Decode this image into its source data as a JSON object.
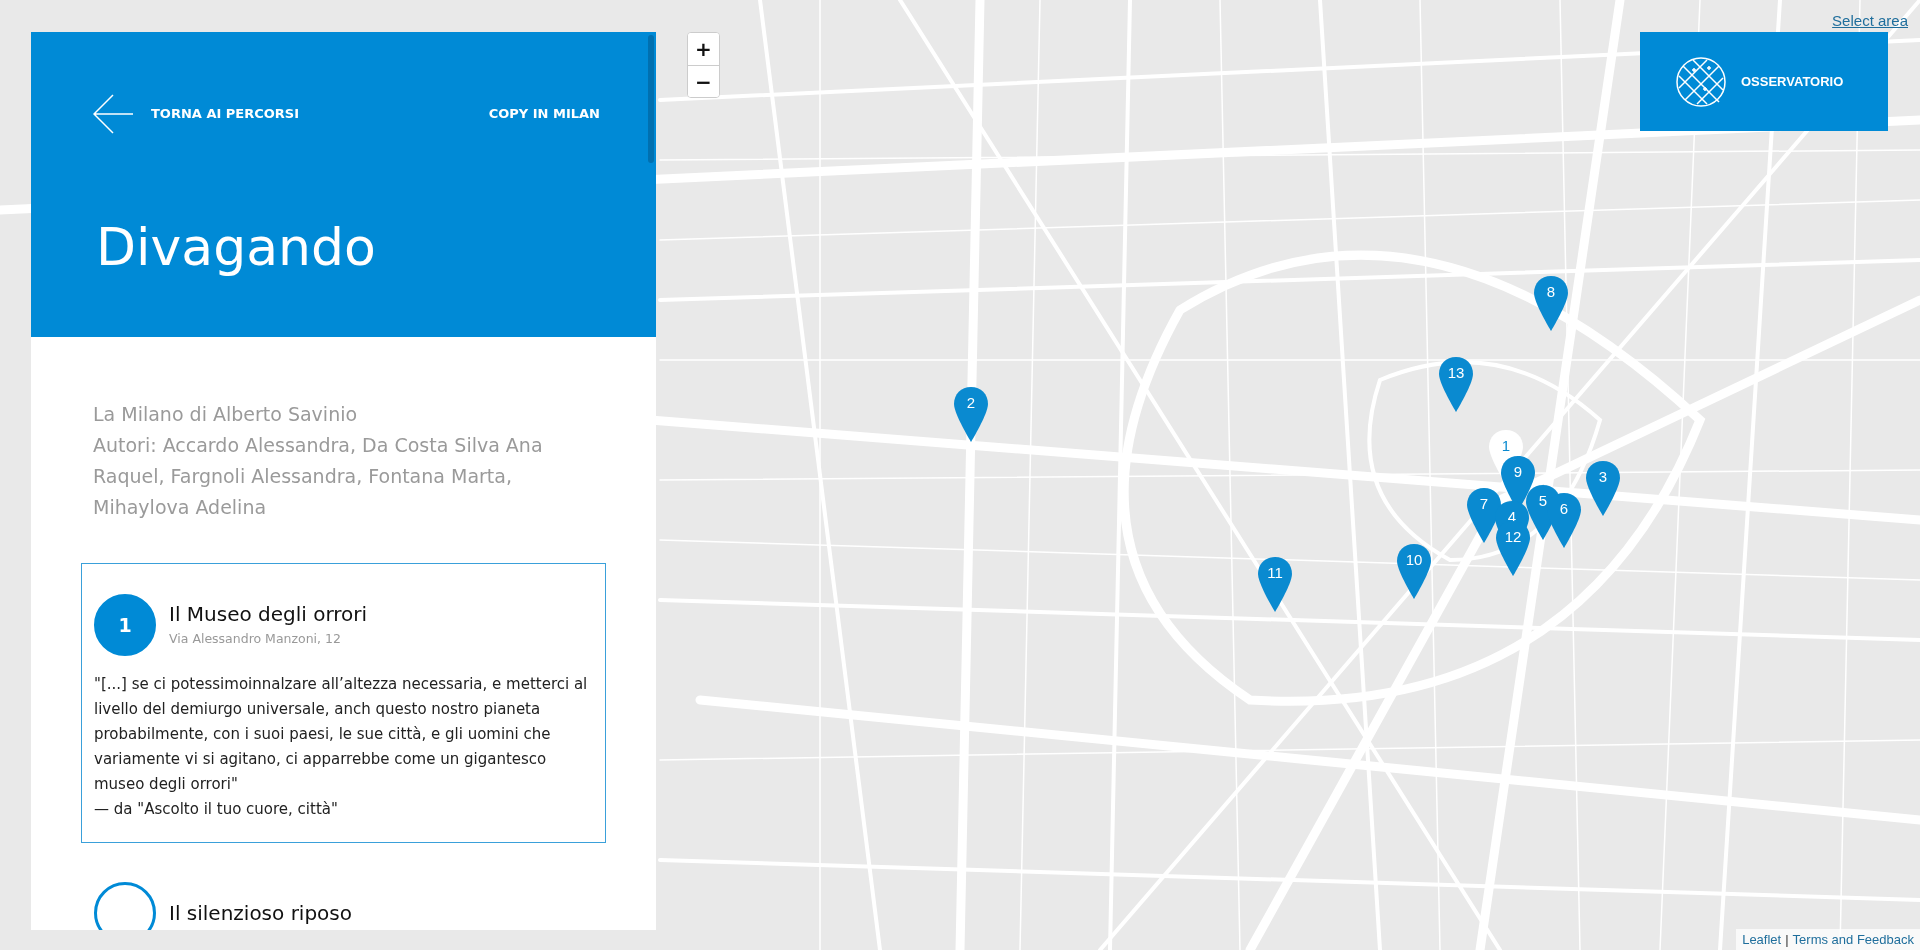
{
  "panel": {
    "back_link": "TORNA AI PERCORSI",
    "city_link": "COPY IN MILAN",
    "title": "Divagando",
    "subtitle": "La Milano di Alberto Savinio",
    "authors": "Autori: Accardo Alessandra, Da Costa Silva Ana Raquel, Fargnoli Alessandra, Fontana Marta, Mihaylova Adelina",
    "stops": [
      {
        "number": "1",
        "title": "Il Museo degli orrori",
        "address": "Via Alessandro Manzoni, 12",
        "quote": "\"[...] se ci potessimoinnalzare all’altezza necessaria, e metterci al livello del demiurgo universale, anch questo nostro pianeta probabilmente, con i suoi paesi, le sue città, e gli uomini che variamente vi si agitano, ci apparrebbe come un gigantesco museo degli orrori\"",
        "source": "— da \"Ascolto il tuo cuore, città\"",
        "selected": true
      },
      {
        "title": "Il silenzioso riposo",
        "selected": false
      }
    ]
  },
  "map": {
    "zoom_in": "+",
    "zoom_out": "−",
    "select_area": "Select area",
    "observatory": "OSSERVATORIO",
    "attribution_link": "Leaflet",
    "attribution_separator": "|",
    "attribution_terms": "Terms and Feedback",
    "markers": [
      {
        "label": "8",
        "selected": false
      },
      {
        "label": "2",
        "selected": false
      },
      {
        "label": "13",
        "selected": false
      },
      {
        "label": "11",
        "selected": false
      },
      {
        "label": "10",
        "selected": false
      },
      {
        "label": "3",
        "selected": false
      },
      {
        "label": "7",
        "selected": false
      },
      {
        "label": "1",
        "selected": true
      },
      {
        "label": "9",
        "selected": false
      },
      {
        "label": "5",
        "selected": false
      },
      {
        "label": "6",
        "selected": false
      },
      {
        "label": "4",
        "selected": false
      },
      {
        "label": "12",
        "selected": false
      }
    ]
  }
}
